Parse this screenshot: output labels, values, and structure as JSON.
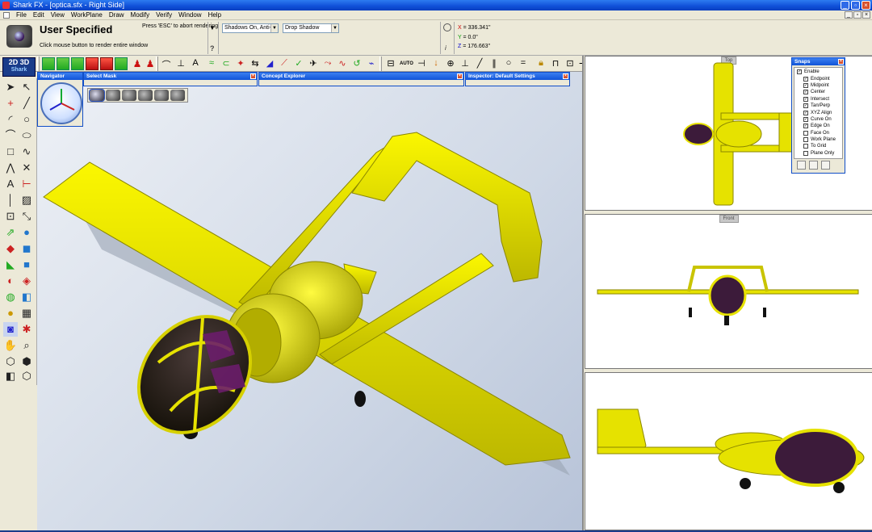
{
  "window": {
    "title": "Shark FX - [optica.sfx - Right Side]"
  },
  "menu": [
    "File",
    "Edit",
    "View",
    "WorkPlane",
    "Draw",
    "Modify",
    "Verify",
    "Window",
    "Help"
  ],
  "render": {
    "mode": "User Specified",
    "esc_hint": "Press 'ESC' to abort rendering",
    "mouse_hint": "Click mouse button to render entire window",
    "shadows_option": "Shadows On, Anti-Ali",
    "shadow_type": "Drop Shadow",
    "help_glyph": "?",
    "info_glyph": "i"
  },
  "coords": {
    "x_label": "X",
    "x_value": "= 336.341\"",
    "y_label": "Y",
    "y_value": "= 0.0\"",
    "z_label": "Z",
    "z_value": "= 176.663\""
  },
  "logo": {
    "line1": "2D 3D",
    "line2": "Shark"
  },
  "toolbar": {
    "auto_label": "AUTO"
  },
  "panels": {
    "navigator": "Navigator",
    "select_mask": "Select Mask",
    "concept_explorer": "Concept Explorer",
    "inspector": "Inspector: Default Settings"
  },
  "views": {
    "top": "Top",
    "front": "Front"
  },
  "snaps": {
    "title": "Snaps",
    "items": [
      {
        "label": "Enable",
        "checked": true,
        "indent": false
      },
      {
        "label": "Endpoint",
        "checked": true,
        "indent": true
      },
      {
        "label": "Midpoint",
        "checked": true,
        "indent": true
      },
      {
        "label": "Center",
        "checked": true,
        "indent": true
      },
      {
        "label": "Intersect",
        "checked": true,
        "indent": true
      },
      {
        "label": "Tan/Perp",
        "checked": true,
        "indent": true
      },
      {
        "label": "XYZ Align",
        "checked": true,
        "indent": true
      },
      {
        "label": "Curve On",
        "checked": true,
        "indent": true
      },
      {
        "label": "Edge On",
        "checked": true,
        "indent": true
      },
      {
        "label": "Face On",
        "checked": false,
        "indent": true
      },
      {
        "label": "Work Plane",
        "checked": false,
        "indent": true
      },
      {
        "label": "To Grid",
        "checked": false,
        "indent": true
      },
      {
        "label": "Plane Only",
        "checked": false,
        "indent": true
      }
    ]
  },
  "colors": {
    "model_yellow": "#e6e200",
    "canopy": "#3c1b3a",
    "title_blue": "#1154d8"
  }
}
